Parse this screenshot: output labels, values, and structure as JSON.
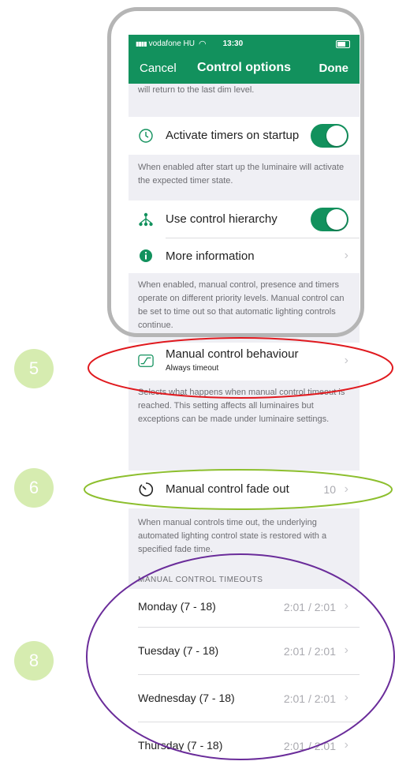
{
  "status_bar": {
    "carrier": "vodafone HU",
    "time": "13:30"
  },
  "nav": {
    "cancel": "Cancel",
    "title": "Control options",
    "done": "Done"
  },
  "top_note": "will return to the last dim level.",
  "timers": {
    "label": "Activate timers on startup",
    "enabled": true,
    "description": "When enabled after start up the luminaire will activate the expected timer state."
  },
  "hierarchy": {
    "label": "Use control hierarchy",
    "enabled": true,
    "more_info": "More information",
    "description": "When enabled, manual control, presence and timers operate on different priority levels. Manual control can be set to time out so that automatic lighting controls continue."
  },
  "behaviour": {
    "label": "Manual control behaviour",
    "value": "Always timeout",
    "description": "Selects what happens when manual control timeout is reached. This setting affects all luminaires but exceptions can be made under luminaire settings."
  },
  "fade": {
    "label": "Manual control fade out",
    "value": "10",
    "description": "When manual controls time out, the underlying automated lighting control state is restored with a specified fade time."
  },
  "timeouts": {
    "header": "MANUAL CONTROL TIMEOUTS",
    "days": [
      {
        "label": "Monday (7 - 18)",
        "value": "2:01 / 2:01"
      },
      {
        "label": "Tuesday (7 - 18)",
        "value": "2:01 / 2:01"
      },
      {
        "label": "Wednesday (7 - 18)",
        "value": "2:01 / 2:01"
      },
      {
        "label": "Thursday (7 - 18)",
        "value": "2:01 / 2:01"
      }
    ]
  },
  "badges": [
    "5",
    "6",
    "8"
  ],
  "colors": {
    "brand": "#12915d",
    "highlight_red": "#e0191e",
    "highlight_green": "#8dbf2e",
    "highlight_purple": "#6a2c9a",
    "badge": "#d6ecb0"
  }
}
